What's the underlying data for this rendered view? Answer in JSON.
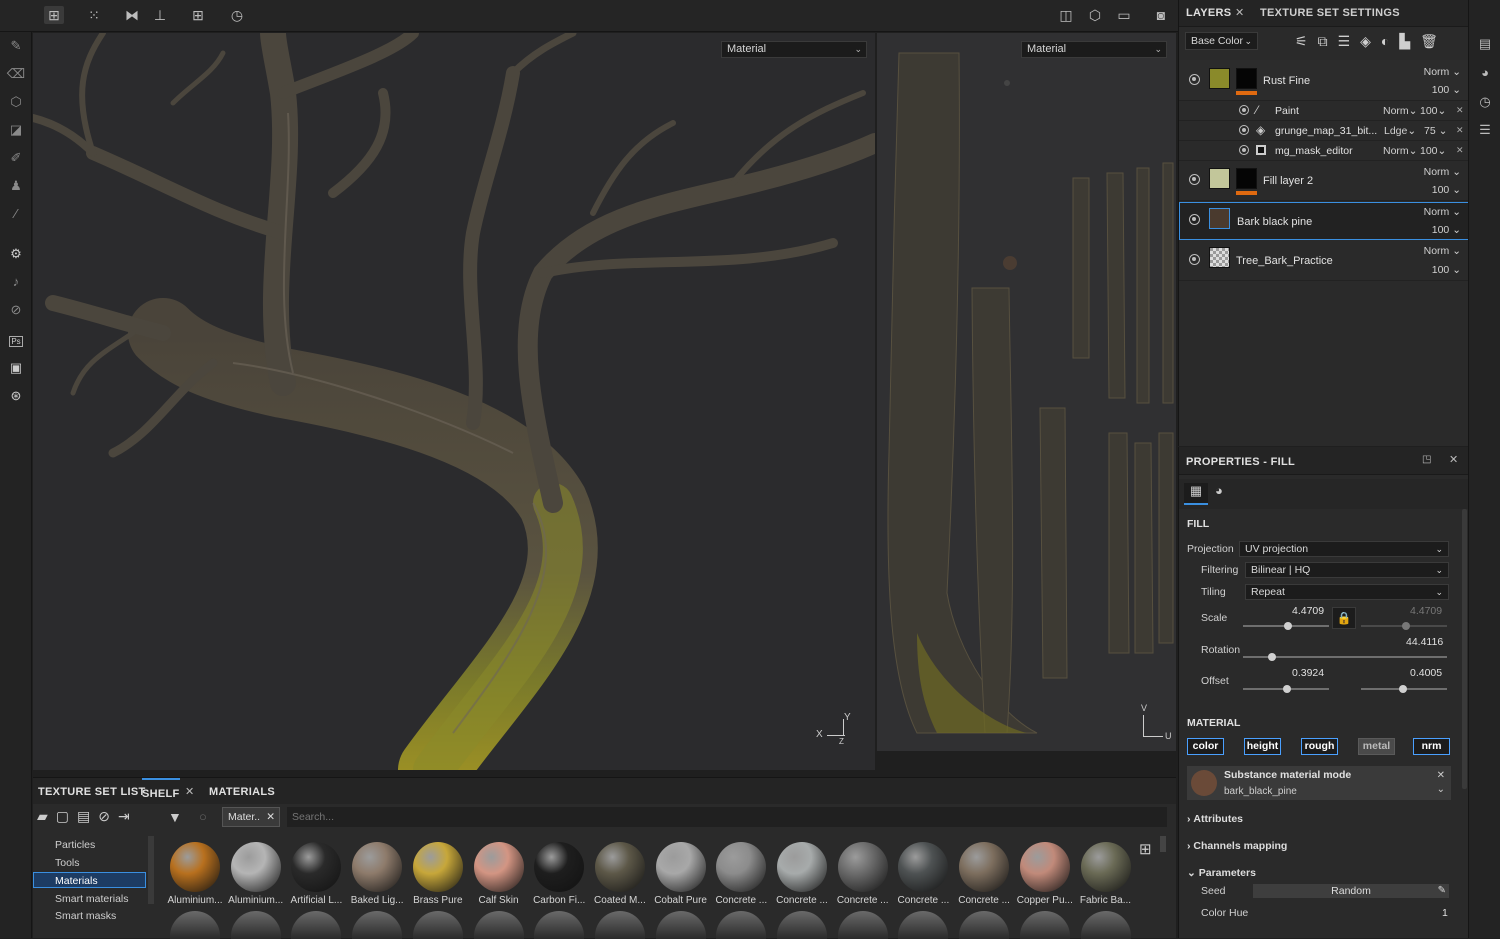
{
  "toolbar": {
    "icons": [
      "select-icon",
      "grid-icon",
      "mirror-icon",
      "align-icon",
      "add-icon",
      "history-icon"
    ],
    "right_icons": [
      "split-view-icon",
      "cube-icon",
      "camera-video-icon",
      "screenshot-icon"
    ]
  },
  "viewport3d": {
    "material_select": "Material",
    "axis_x": "X",
    "axis_y": "Y",
    "axis_z": "Z"
  },
  "viewport2d": {
    "material_select": "Material",
    "axis_v": "V",
    "axis_u": "U"
  },
  "layers_panel": {
    "tab_layers": "LAYERS",
    "tab_texture_set": "TEXTURE SET SETTINGS",
    "channel_select": "Base Color",
    "layers": [
      {
        "name": "Rust Fine",
        "blend": "Norm",
        "opacity": "100"
      },
      {
        "name": "Fill layer 2",
        "blend": "Norm",
        "opacity": "100"
      },
      {
        "name": "Bark black pine",
        "blend": "Norm",
        "opacity": "100"
      },
      {
        "name": "Tree_Bark_Practice",
        "blend": "Norm",
        "opacity": "100"
      }
    ],
    "sublayers": [
      {
        "name": "Paint",
        "blend": "Norm",
        "opacity": "100"
      },
      {
        "name": "grunge_map_31_bit...",
        "blend": "Ldge",
        "opacity": "75"
      },
      {
        "name": "mg_mask_editor",
        "blend": "Norm",
        "opacity": "100"
      }
    ]
  },
  "properties": {
    "title": "PROPERTIES - FILL",
    "fill_section": "FILL",
    "projection_label": "Projection",
    "projection_value": "UV projection",
    "filtering_label": "Filtering",
    "filtering_value": "Bilinear | HQ",
    "tiling_label": "Tiling",
    "tiling_value": "Repeat",
    "scale_label": "Scale",
    "scale_value_1": "4.4709",
    "scale_value_2": "4.4709",
    "rotation_label": "Rotation",
    "rotation_value": "44.4116",
    "offset_label": "Offset",
    "offset_value_1": "0.3924",
    "offset_value_2": "0.4005",
    "material_section": "MATERIAL",
    "channels": [
      "color",
      "height",
      "rough",
      "metal",
      "nrm"
    ],
    "substance_mode": "Substance material mode",
    "substance_name": "bark_black_pine",
    "attributes": "Attributes",
    "channels_mapping": "Channels mapping",
    "parameters": "Parameters",
    "seed_label": "Seed",
    "seed_value": "Random",
    "color_hue_label": "Color Hue",
    "color_hue_value": "1"
  },
  "slider_levels": {
    "scale": 0.52,
    "scale_2": 0.52,
    "rotation": 0.14,
    "offset_1": 0.51,
    "offset_2": 0.49
  },
  "bottom": {
    "tabs": [
      "TEXTURE SET LIST",
      "SHELF",
      "MATERIALS"
    ],
    "filter_chip": "Mater..",
    "search_placeholder": "Search...",
    "categories": [
      "Particles",
      "Tools",
      "Materials",
      "Smart materials",
      "Smart masks"
    ],
    "materials": [
      {
        "label": "Aluminium...",
        "color": "#b8701e"
      },
      {
        "label": "Aluminium...",
        "color": "#b5b5b5"
      },
      {
        "label": "Artificial L...",
        "color": "#2a2a2a"
      },
      {
        "label": "Baked Lig...",
        "color": "#8e7b6b"
      },
      {
        "label": "Brass Pure",
        "color": "#c7a73a"
      },
      {
        "label": "Calf Skin",
        "color": "#d39583"
      },
      {
        "label": "Carbon Fi...",
        "color": "#1e1e1e"
      },
      {
        "label": "Coated M...",
        "color": "#5d5848"
      },
      {
        "label": "Cobalt Pure",
        "color": "#a8a8a8"
      },
      {
        "label": "Concrete ...",
        "color": "#8c8c8c"
      },
      {
        "label": "Concrete ...",
        "color": "#a7abab"
      },
      {
        "label": "Concrete ...",
        "color": "#6c6c6c"
      },
      {
        "label": "Concrete ...",
        "color": "#4e5253"
      },
      {
        "label": "Concrete ...",
        "color": "#7d6e5e"
      },
      {
        "label": "Copper Pu...",
        "color": "#c18a7a"
      },
      {
        "label": "Fabric Ba...",
        "color": "#6a6a55"
      }
    ]
  }
}
